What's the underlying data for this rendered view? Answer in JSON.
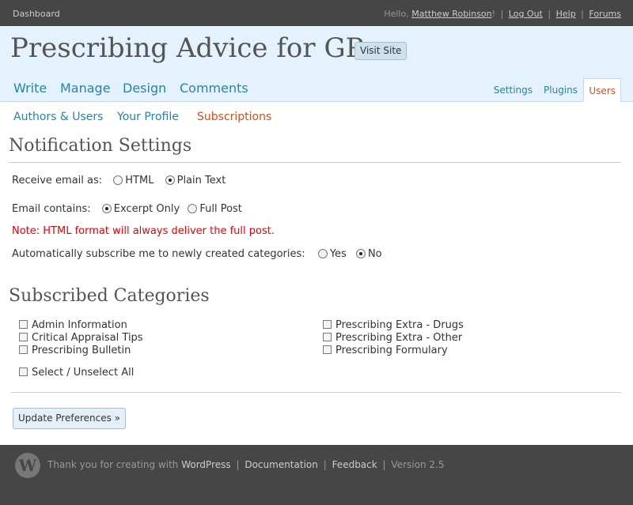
{
  "topbar": {
    "dashboard": "Dashboard",
    "greeting": "Hello,",
    "user_name": "Matthew Robinson",
    "exclaim": "!",
    "logout": "Log Out",
    "help": "Help",
    "forums": "Forums"
  },
  "header": {
    "site_title": "Prescribing Advice for GPs",
    "visit_site": "Visit Site"
  },
  "main_nav": [
    "Write",
    "Manage",
    "Design",
    "Comments"
  ],
  "side_menu": [
    "Settings",
    "Plugins",
    "Users"
  ],
  "sub_menu": [
    "Authors & Users",
    "Your Profile",
    "Subscriptions"
  ],
  "notification": {
    "heading": "Notification Settings",
    "email_as_label": "Receive email as:",
    "email_as_options": [
      "HTML",
      "Plain Text"
    ],
    "email_as_selected": "Plain Text",
    "contains_label": "Email contains:",
    "contains_options": [
      "Excerpt Only",
      "Full Post"
    ],
    "contains_selected": "Excerpt Only",
    "note": "Note: HTML format will always deliver the full post.",
    "auto_label": "Automatically subscribe me to newly created categories:",
    "auto_options": [
      "Yes",
      "No"
    ],
    "auto_selected": "No"
  },
  "categories": {
    "heading": "Subscribed Categories",
    "left": [
      "Admin Information",
      "Critical Appraisal Tips",
      "Prescribing Bulletin"
    ],
    "right": [
      "Prescribing Extra - Drugs",
      "Prescribing Extra - Other",
      "Prescribing Formulary"
    ],
    "select_all": "Select / Unselect All"
  },
  "update_button": "Update Preferences »",
  "footer": {
    "thanks": "Thank you for creating with",
    "wordpress": "WordPress",
    "documentation": "Documentation",
    "feedback": "Feedback",
    "version": "Version 2.5"
  },
  "colors": {
    "topbar": "#464646",
    "header": "#e4f2fd",
    "link": "#2583ad",
    "current": "#d54e21",
    "note": "#e00000"
  }
}
